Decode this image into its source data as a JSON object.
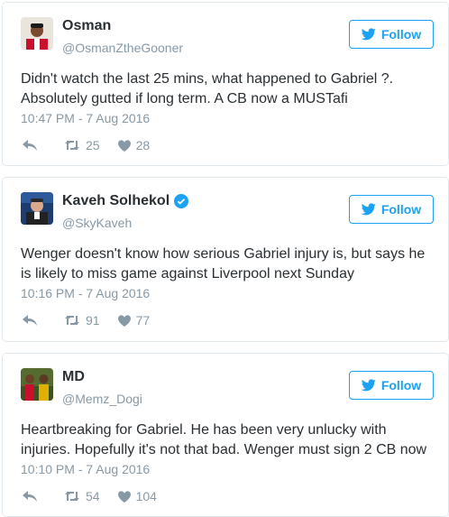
{
  "follow_label": "Follow",
  "tweets": [
    {
      "name": "Osman",
      "handle": "@OsmanZtheGooner",
      "verified": false,
      "text": "Didn't watch the last 25 mins, what happened to Gabriel ?.\nAbsolutely gutted if long term. A CB now a MUSTafi",
      "time": "10:47 PM - 7 Aug 2016",
      "retweets": "25",
      "likes": "28"
    },
    {
      "name": "Kaveh Solhekol",
      "handle": "@SkyKaveh",
      "verified": true,
      "text": "Wenger doesn't know how serious Gabriel injury is, but says he\nis likely to miss game against Liverpool next Sunday",
      "time": "10:16 PM - 7 Aug 2016",
      "retweets": "91",
      "likes": "77"
    },
    {
      "name": "MD",
      "handle": "@Memz_Dogi",
      "verified": false,
      "text": "Heartbreaking for Gabriel. He has been very unlucky with\ninjuries. Hopefully it's not that bad. Wenger must sign 2 CB now",
      "time": "10:10 PM - 7 Aug 2016",
      "retweets": "54",
      "likes": "104"
    }
  ],
  "colors": {
    "accent": "#1da1f2",
    "muted": "#8899a6",
    "text": "#292f33",
    "border": "#e1e8ed"
  }
}
